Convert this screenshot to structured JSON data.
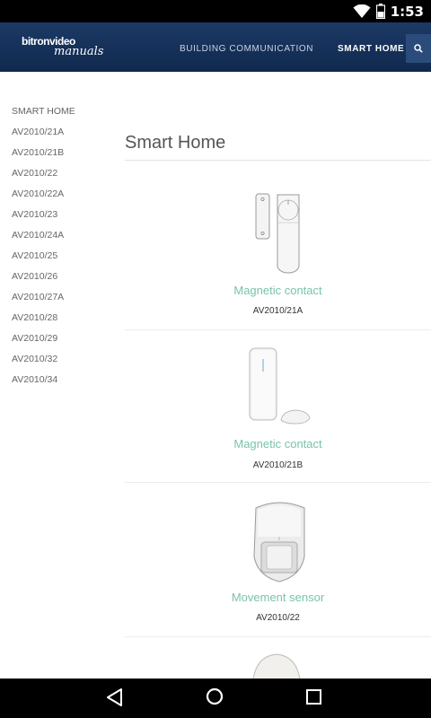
{
  "status_bar": {
    "time": "1:53"
  },
  "header": {
    "logo_top": "bitronvideo",
    "logo_bottom": "manuals",
    "nav": [
      "BUILDING COMMUNICATION",
      "SMART HOME"
    ]
  },
  "sidebar": {
    "items": [
      "SMART HOME",
      "AV2010/21A",
      "AV2010/21B",
      "AV2010/22",
      "AV2010/22A",
      "AV2010/23",
      "AV2010/24A",
      "AV2010/25",
      "AV2010/26",
      "AV2010/27A",
      "AV2010/28",
      "AV2010/29",
      "AV2010/32",
      "AV2010/34"
    ]
  },
  "main": {
    "title": "Smart Home",
    "products": [
      {
        "name": "Magnetic contact",
        "code": "AV2010/21A"
      },
      {
        "name": "Magnetic contact",
        "code": "AV2010/21B"
      },
      {
        "name": "Movement sensor",
        "code": "AV2010/22"
      }
    ]
  },
  "colors": {
    "header": "#1c3a66",
    "product_name": "#78c3ad",
    "accent": "#2b4c7a"
  }
}
